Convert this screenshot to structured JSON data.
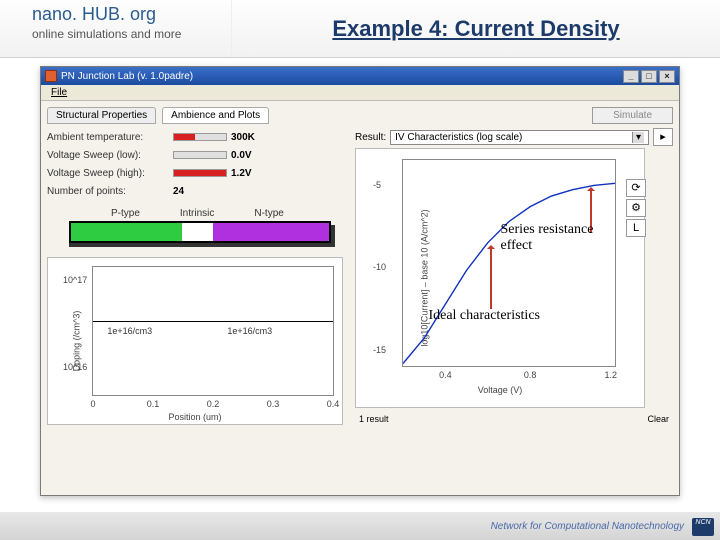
{
  "header": {
    "brand": "nano. HUB. org",
    "tagline": "online simulations and more",
    "title": "Example 4: Current Density"
  },
  "window": {
    "title": "PN Junction Lab (v. 1.0padre)",
    "menu": {
      "file": "File"
    },
    "tabs": {
      "structural": "Structural Properties",
      "ambience": "Ambience and Plots"
    },
    "simulate_btn": "Simulate"
  },
  "params": {
    "temp_label": "Ambient temperature:",
    "temp_val": "300K",
    "vlow_label": "Voltage Sweep (low):",
    "vlow_val": "0.0V",
    "vhigh_label": "Voltage Sweep (high):",
    "vhigh_val": "1.2V",
    "npts_label": "Number of points:",
    "npts_val": "24"
  },
  "regions": {
    "p": "P-type",
    "i": "Intrinsic",
    "n": "N-type"
  },
  "left_chart": {
    "ylabel": "Doping (/cm^3)",
    "xlabel": "Position (um)",
    "ymax": "10^17",
    "ymid": "10^16",
    "xticks": [
      "0",
      "0.1",
      "0.2",
      "0.3",
      "0.4"
    ],
    "d1": "1e+16/cm3",
    "d2": "1e+16/cm3"
  },
  "result": {
    "label": "Result:",
    "selected": "IV Characteristics (log scale)"
  },
  "right_chart": {
    "ylabel": "log10[Current] – base 10 (A/cm^2)",
    "yticks": [
      "-5",
      "-10",
      "-15"
    ],
    "xticks": [
      "0.4",
      "0.8",
      "1.2"
    ],
    "xlabel_unit": "Voltage (V)",
    "annot_series": "Series resistance effect",
    "annot_ideal": "Ideal characteristics",
    "status_left": "1 result",
    "status_right": "Clear"
  },
  "footer": {
    "text": "Network for Computational Nanotechnology",
    "badge": "NCN"
  },
  "chart_data": {
    "type": "line",
    "title": "IV Characteristics (log scale)",
    "xlabel": "Voltage (V)",
    "ylabel": "log10[Current] (A/cm^2)",
    "xlim": [
      0.2,
      1.2
    ],
    "ylim": [
      -15,
      -3
    ],
    "series": [
      {
        "name": "IV",
        "x": [
          0.2,
          0.3,
          0.4,
          0.5,
          0.6,
          0.7,
          0.8,
          0.9,
          1.0,
          1.1,
          1.2
        ],
        "values": [
          -14.5,
          -13.0,
          -11.0,
          -9.0,
          -7.4,
          -6.2,
          -5.4,
          -4.9,
          -4.6,
          -4.4,
          -4.3
        ]
      }
    ]
  }
}
